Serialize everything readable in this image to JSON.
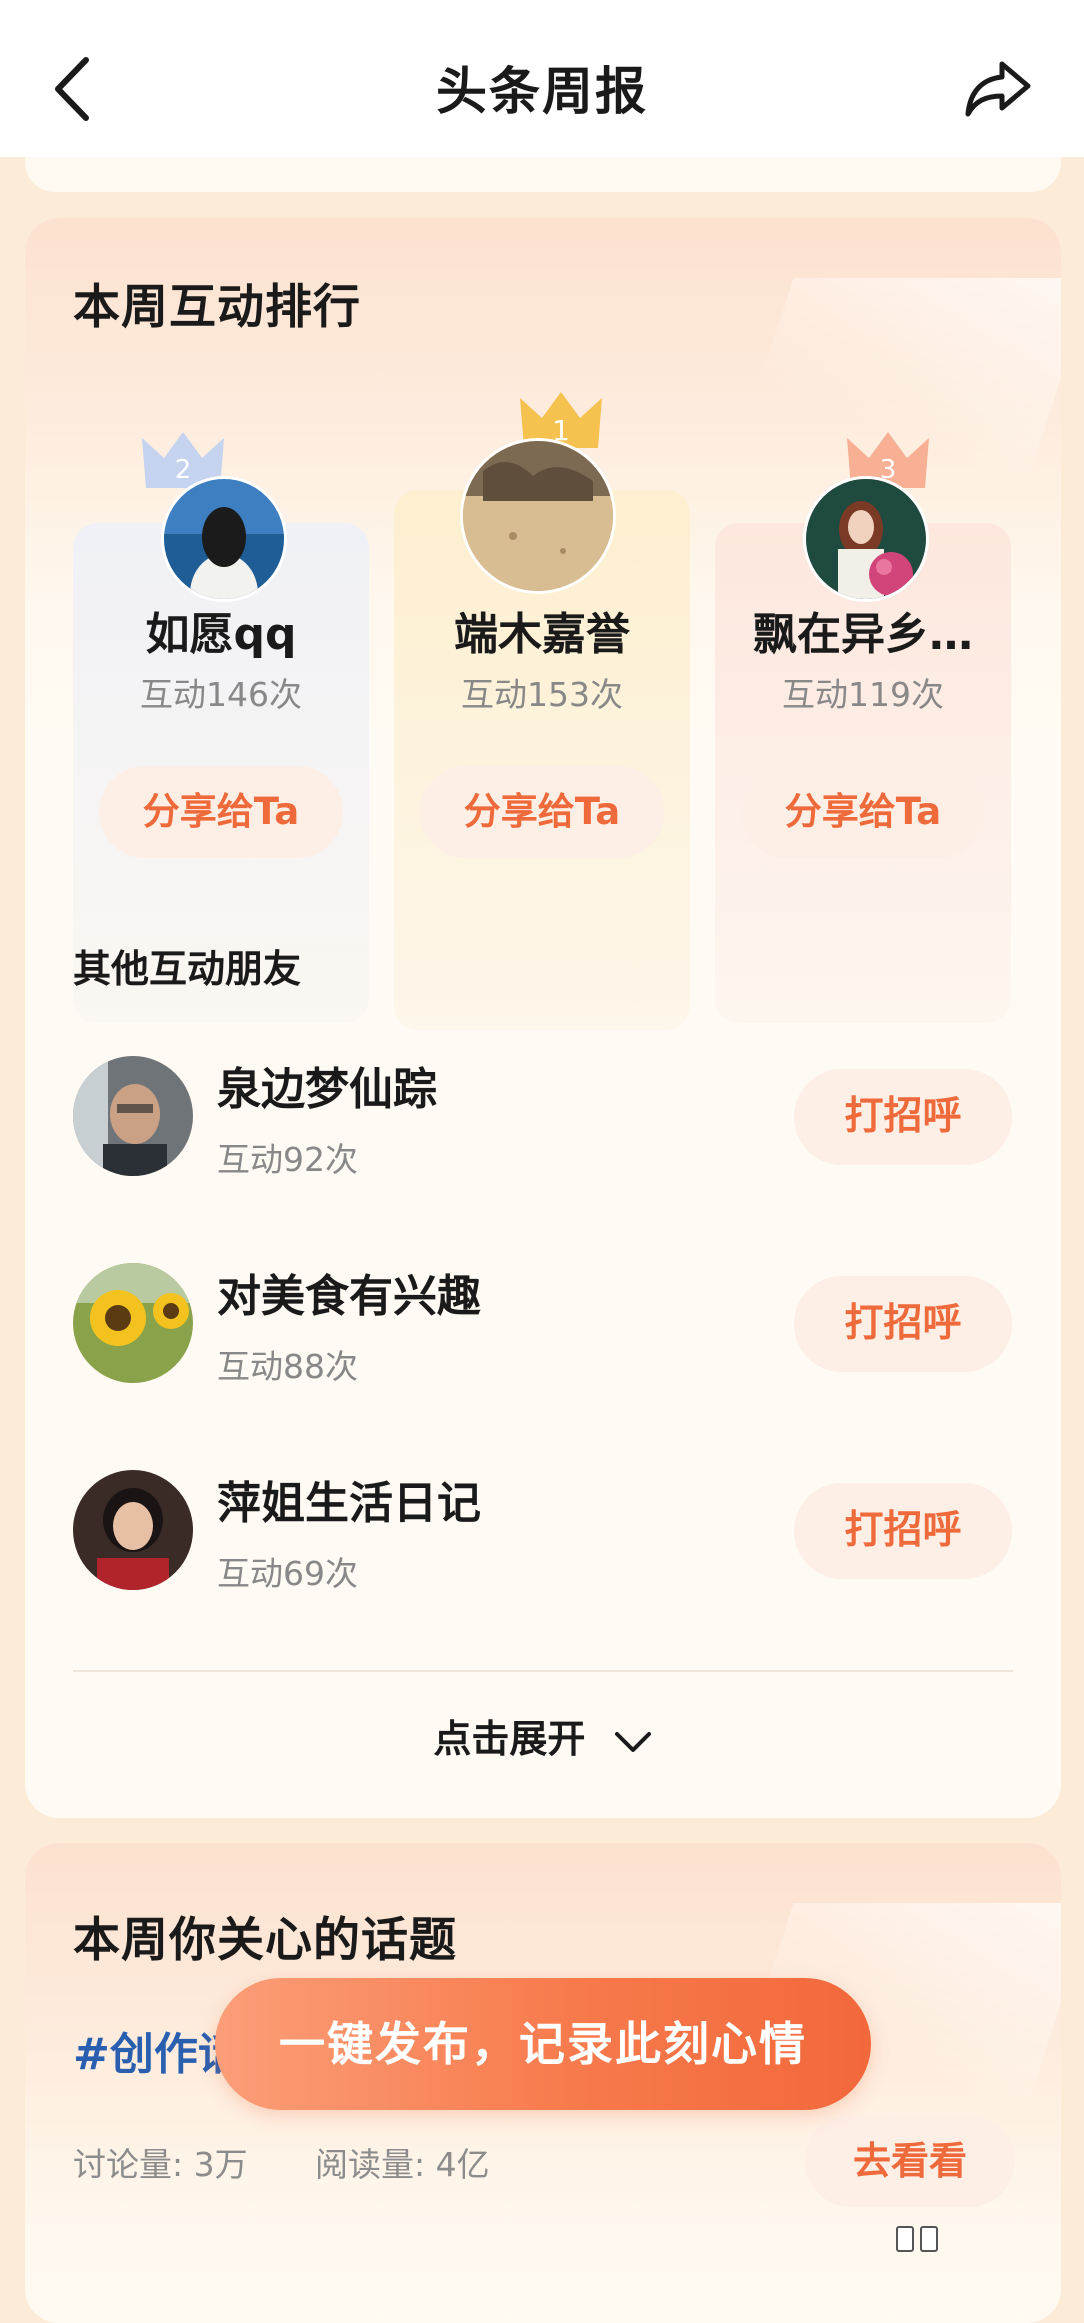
{
  "header": {
    "title": "头条周报"
  },
  "ranking": {
    "title": "本周互动排行",
    "top": [
      {
        "rank": "1",
        "name": "端木嘉誉",
        "count": "互动153次",
        "button": "分享给Ta"
      },
      {
        "rank": "2",
        "name": "如愿qq",
        "count": "互动146次",
        "button": "分享给Ta"
      },
      {
        "rank": "3",
        "name": "飘在异乡…",
        "count": "互动119次",
        "button": "分享给Ta"
      }
    ],
    "others_title": "其他互动朋友",
    "others": [
      {
        "name": "泉边梦仙踪",
        "count": "互动92次",
        "button": "打招呼"
      },
      {
        "name": "对美食有兴趣",
        "count": "互动88次",
        "button": "打招呼"
      },
      {
        "name": "萍姐生活日记",
        "count": "互动69次",
        "button": "打招呼"
      }
    ],
    "expand_label": "点击展开"
  },
  "topics": {
    "title": "本周你关心的话题",
    "hashtag": "#创作话",
    "discussion": "讨论量: 3万",
    "reads": "阅读量: 4亿",
    "button": "去看看"
  },
  "floating_button": "一键发布，记录此刻心情",
  "colors": {
    "accent": "#ef6a3a",
    "hashtag": "#2a5fb0",
    "crown_gold": "#f5b942",
    "crown_silver": "#9bbcf0",
    "crown_bronze": "#f59a7a"
  }
}
